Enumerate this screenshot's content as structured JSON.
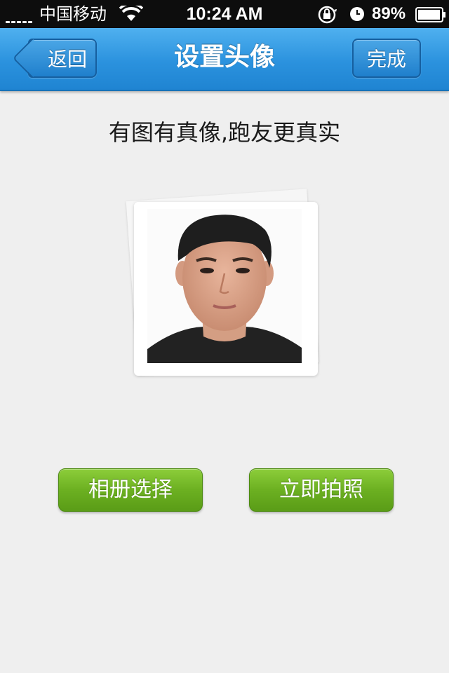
{
  "status_bar": {
    "carrier": "中国移动",
    "time": "10:24 AM",
    "battery_percent": "89%",
    "icons": [
      "signal-icon",
      "wifi-icon",
      "orientation-lock-icon",
      "alarm-icon",
      "battery-icon"
    ]
  },
  "nav": {
    "back_label": "返回",
    "title": "设置头像",
    "done_label": "完成"
  },
  "main": {
    "subtitle": "有图有真像,跑友更真实",
    "avatar_icon": "user-photo"
  },
  "actions": {
    "album_label": "相册选择",
    "camera_label": "立即拍照"
  },
  "colors": {
    "nav_blue": "#2b92de",
    "button_green": "#6cb021",
    "background": "#efefef"
  }
}
